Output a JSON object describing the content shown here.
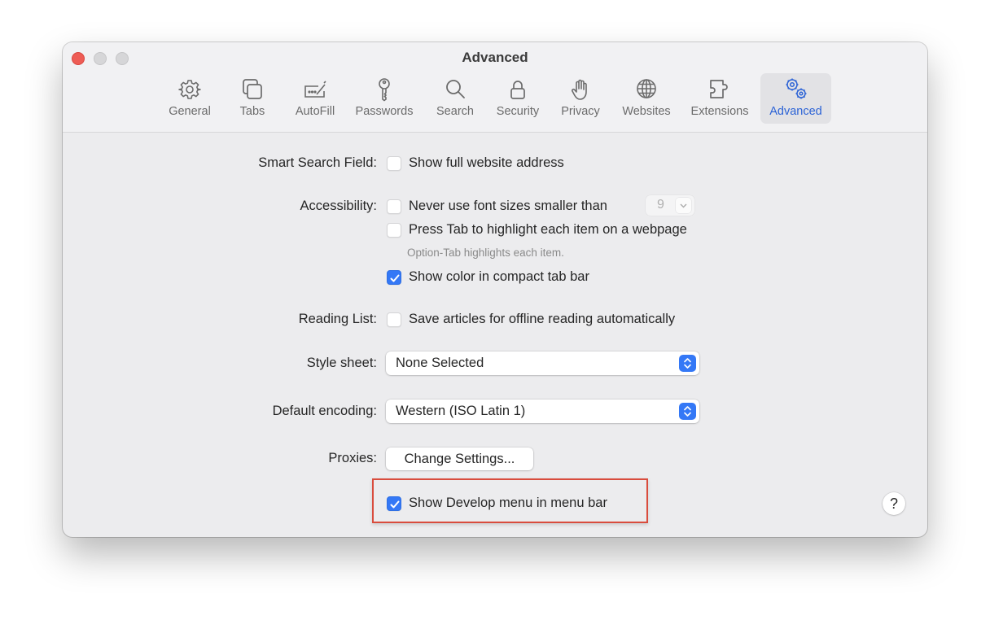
{
  "window": {
    "title": "Advanced",
    "accent_color": "#3478f6",
    "highlight_color": "#d94c3d"
  },
  "toolbar": {
    "tabs": [
      {
        "label": "General",
        "icon": "gear-icon",
        "active": false
      },
      {
        "label": "Tabs",
        "icon": "tabs-icon",
        "active": false
      },
      {
        "label": "AutoFill",
        "icon": "autofill-icon",
        "active": false
      },
      {
        "label": "Passwords",
        "icon": "key-icon",
        "active": false
      },
      {
        "label": "Search",
        "icon": "search-icon",
        "active": false
      },
      {
        "label": "Security",
        "icon": "lock-icon",
        "active": false
      },
      {
        "label": "Privacy",
        "icon": "hand-icon",
        "active": false
      },
      {
        "label": "Websites",
        "icon": "globe-icon",
        "active": false
      },
      {
        "label": "Extensions",
        "icon": "puzzle-icon",
        "active": false
      },
      {
        "label": "Advanced",
        "icon": "gears-icon",
        "active": true
      }
    ]
  },
  "settings": {
    "smart_search": {
      "label": "Smart Search Field:",
      "option": "Show full website address",
      "checked": false
    },
    "accessibility": {
      "label": "Accessibility:",
      "font_size_option": "Never use font sizes smaller than",
      "font_size_checked": false,
      "font_size_value": "9",
      "tab_highlight_option": "Press Tab to highlight each item on a webpage",
      "tab_highlight_checked": false,
      "tab_highlight_hint": "Option-Tab highlights each item.",
      "color_tab_option": "Show color in compact tab bar",
      "color_tab_checked": true
    },
    "reading_list": {
      "label": "Reading List:",
      "option": "Save articles for offline reading automatically",
      "checked": false
    },
    "style_sheet": {
      "label": "Style sheet:",
      "value": "None Selected"
    },
    "default_encoding": {
      "label": "Default encoding:",
      "value": "Western (ISO Latin 1)"
    },
    "proxies": {
      "label": "Proxies:",
      "button": "Change Settings..."
    },
    "develop_menu": {
      "option": "Show Develop menu in menu bar",
      "checked": true
    },
    "help_button": "?"
  }
}
